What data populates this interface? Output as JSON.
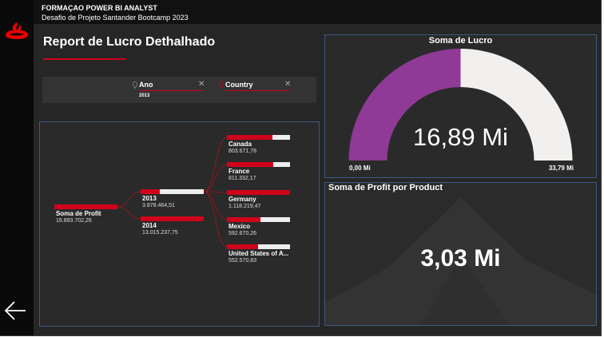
{
  "header": {
    "title": "FORMAÇAO POWER BI ANALYST",
    "subtitle": "Desafio de Projeto Santander Bootcamp 2023"
  },
  "page": {
    "title": "Report de Lucro Dethalhado"
  },
  "filters": [
    {
      "label": "Ano",
      "value": "2013"
    },
    {
      "label": "Country",
      "value": ""
    }
  ],
  "tree": {
    "root": {
      "label": "Soma de Profit",
      "value": "16.893.702,26"
    },
    "level1": [
      {
        "label": "2013",
        "value": "3.878.464,51",
        "fraction": 0.3
      },
      {
        "label": "2014",
        "value": "13.015.237,75",
        "fraction": 1.0
      }
    ],
    "level2": [
      {
        "label": "Canada",
        "value": "803.671,78",
        "fraction": 0.72
      },
      {
        "label": "France",
        "value": "811.332,17",
        "fraction": 0.73
      },
      {
        "label": "Germany",
        "value": "1.118.219,47",
        "fraction": 1.0
      },
      {
        "label": "Mexico",
        "value": "592.670,26",
        "fraction": 0.53
      },
      {
        "label": "United States of A...",
        "value": "552.570,83",
        "fraction": 0.49
      }
    ]
  },
  "gauge": {
    "title": "Soma de Lucro",
    "value_label": "16,89 Mi",
    "min_label": "0,00 Mi",
    "max_label": "33,79 Mi",
    "fraction": 0.5,
    "fill_color": "#8e3a96",
    "track_color": "#f2f0ee"
  },
  "card": {
    "title": "Soma de Profit por Product",
    "value_label": "3,03 Mi"
  },
  "colors": {
    "accent": "#d0021b",
    "bar_track": "#eeeeee",
    "panel_border": "#3d5a80"
  }
}
